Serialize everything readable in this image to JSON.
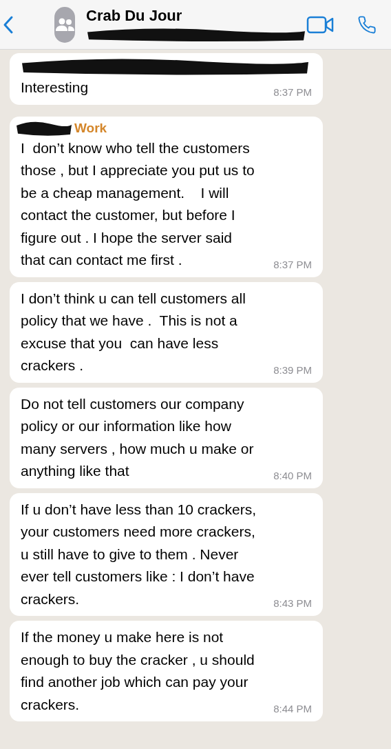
{
  "header": {
    "title": "Crab Du Jour",
    "subtitle_redacted": true
  },
  "messages": [
    {
      "redacted_line": true,
      "text": "Interesting",
      "time": "8:37 PM"
    },
    {
      "sender": {
        "name": "Work",
        "color": "#d4862a",
        "name_redacted": true
      },
      "text": "I  don’t know who tell the customers\nthose , but I appreciate you put us to\nbe a cheap management.    I will\ncontact the customer, but before I\nfigure out . I hope the server said\nthat can contact me first .",
      "time": "8:37 PM"
    },
    {
      "text": "I don’t think u can tell customers all\npolicy that we have .  This is not a\nexcuse that you  can have less\ncrackers .",
      "time": "8:39 PM"
    },
    {
      "text": "Do not tell customers our company\npolicy or our information like how\nmany servers , how much u make or\nanything like that",
      "time": "8:40 PM"
    },
    {
      "text": "If u don’t have less than 10 crackers,\nyour customers need more crackers,\nu still have to give to them . Never\never tell customers like : I don’t have\ncrackers.",
      "time": "8:43 PM"
    },
    {
      "text": "If the money u make here is not\nenough to buy the cracker , u should\nfind another job which can pay your\ncrackers.",
      "time": "8:44 PM"
    }
  ]
}
